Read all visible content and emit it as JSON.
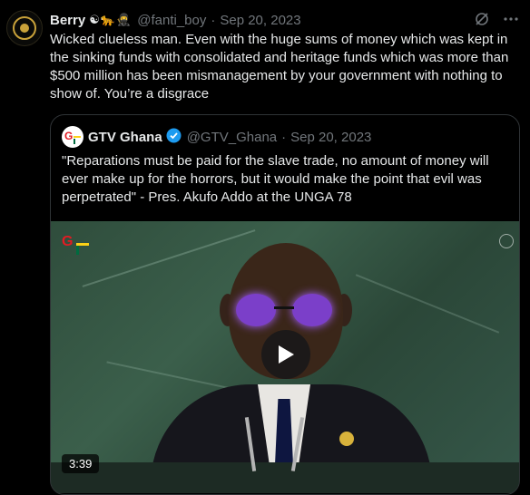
{
  "tweet": {
    "author_name": "Berry",
    "author_emojis": "☯🐆🥷",
    "handle": "@fanti_boy",
    "separator": "·",
    "date": "Sep 20, 2023",
    "text": "Wicked clueless man. Even with the huge sums of money which was kept in the sinking funds with consolidated and heritage funds which was more than $500 million has been mismanagement by your government with nothing to show of. You’re a disgrace",
    "avatar_icon": "gold-emblem-avatar",
    "action_icons": [
      "grok-icon",
      "more-icon"
    ]
  },
  "quote": {
    "author_name": "GTV Ghana",
    "verified_color": "#1d9bf0",
    "handle": "@GTV_Ghana",
    "separator": "·",
    "date": "Sep 20, 2023",
    "text": "\"Reparations must be paid for the slave trade, no amount of money will ever make up for the horrors, but it would make the point that evil was perpetrated\" - Pres. Akufo Addo at the UNGA 78",
    "video": {
      "duration": "3:39",
      "play_icon": "play-icon"
    }
  },
  "colors": {
    "background": "#000000",
    "text": "#e7e9ea",
    "muted": "#71767b",
    "border": "#2f3336"
  }
}
